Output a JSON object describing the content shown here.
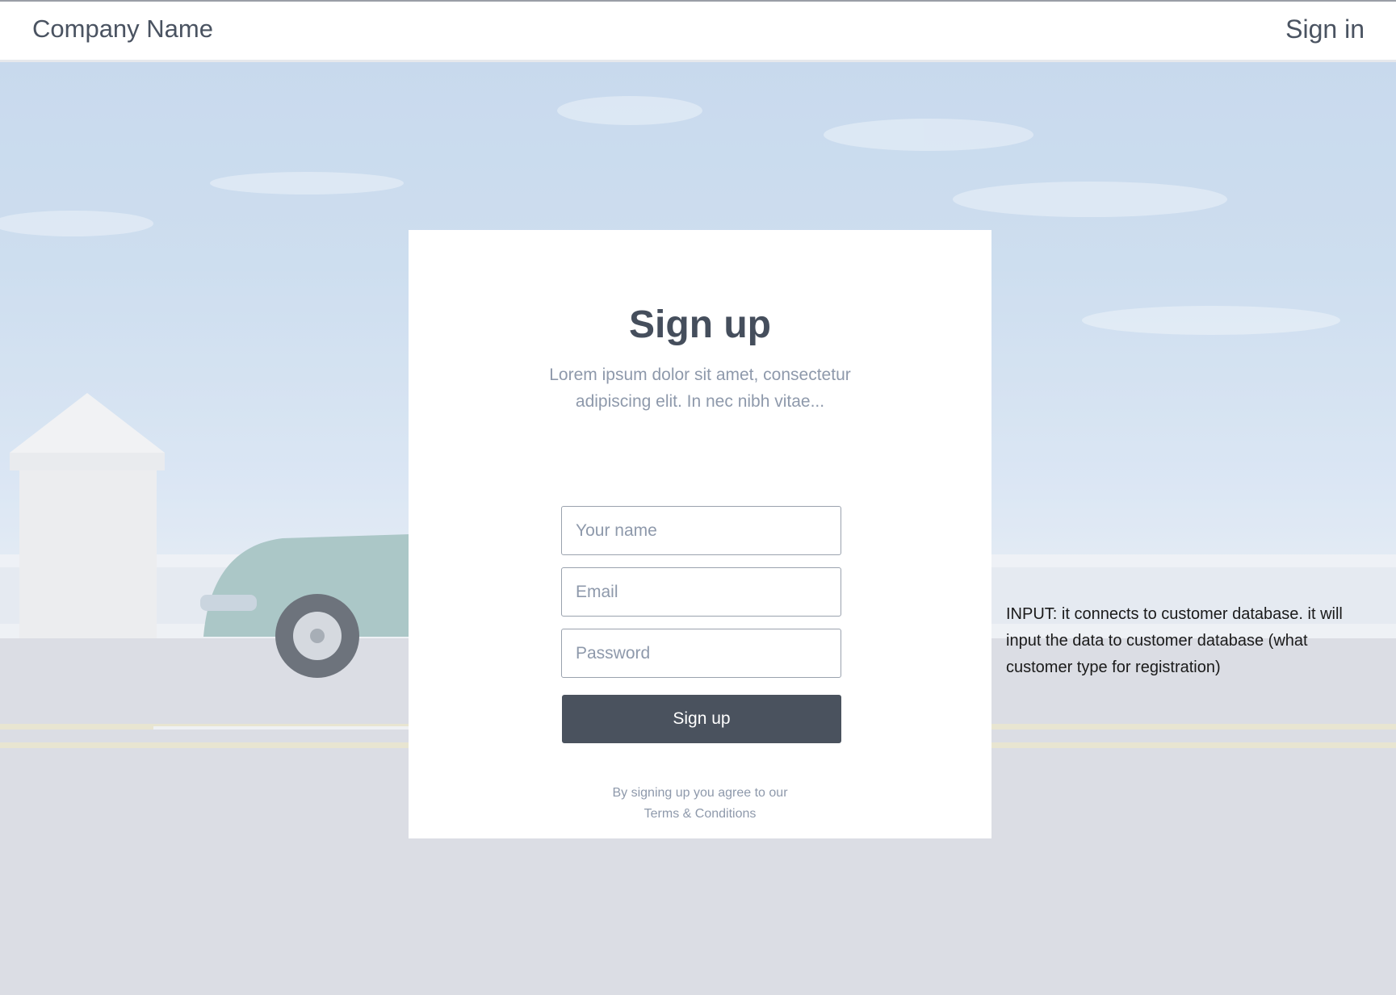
{
  "header": {
    "brand": "Company Name",
    "signin_label": "Sign in"
  },
  "signup": {
    "title": "Sign up",
    "subtitle": "Lorem ipsum dolor sit amet, consectetur adipiscing elit. In nec nibh vitae...",
    "name_placeholder": "Your name",
    "email_placeholder": "Email",
    "password_placeholder": "Password",
    "submit_label": "Sign up",
    "agree_text": "By signing up you agree to our",
    "terms_label": "Terms & Conditions"
  },
  "annotation": {
    "text": "INPUT: it connects to customer database. it will input the data to customer database (what customer type for registration)"
  },
  "colors": {
    "primary_button": "#4a525e",
    "text_dark": "#454e5c",
    "text_muted": "#8e99ab"
  }
}
